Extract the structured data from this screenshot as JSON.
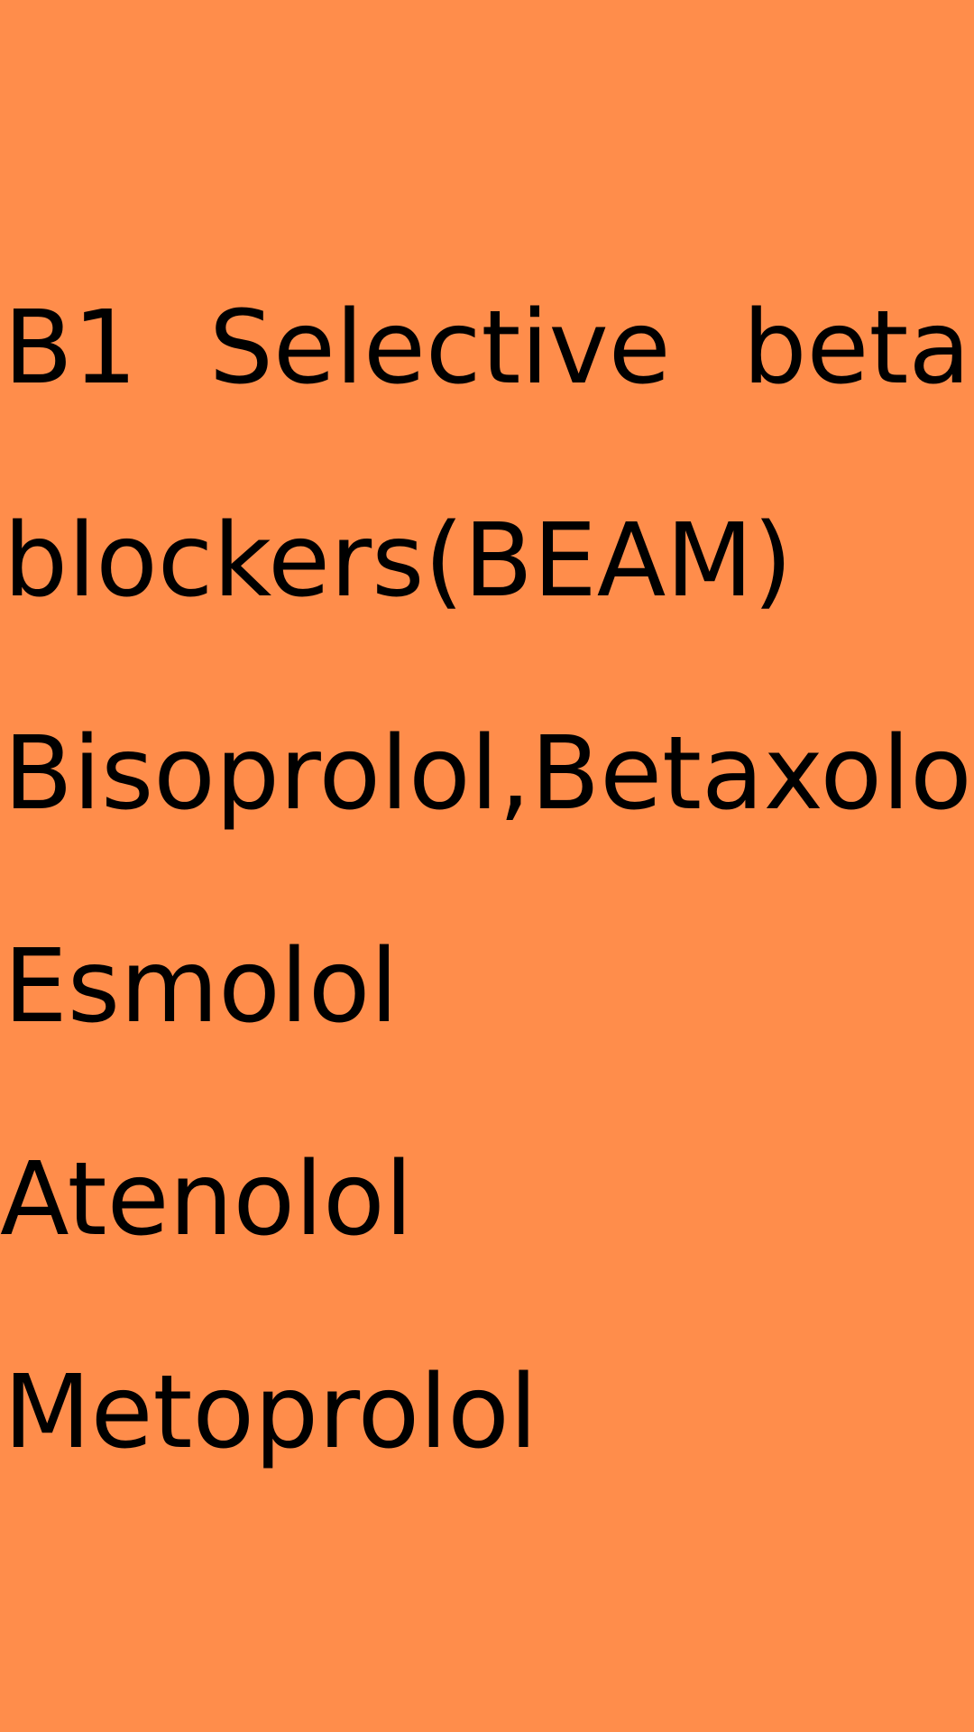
{
  "background_color": "#ff8d4b",
  "text_color": "#000000",
  "heading_words": [
    "B1",
    "Selective",
    "beta"
  ],
  "lines": [
    "blockers(BEAM)",
    "Bisoprolol,Betaxolol",
    "Esmolol",
    "Atenolol",
    "Metoprolol"
  ]
}
